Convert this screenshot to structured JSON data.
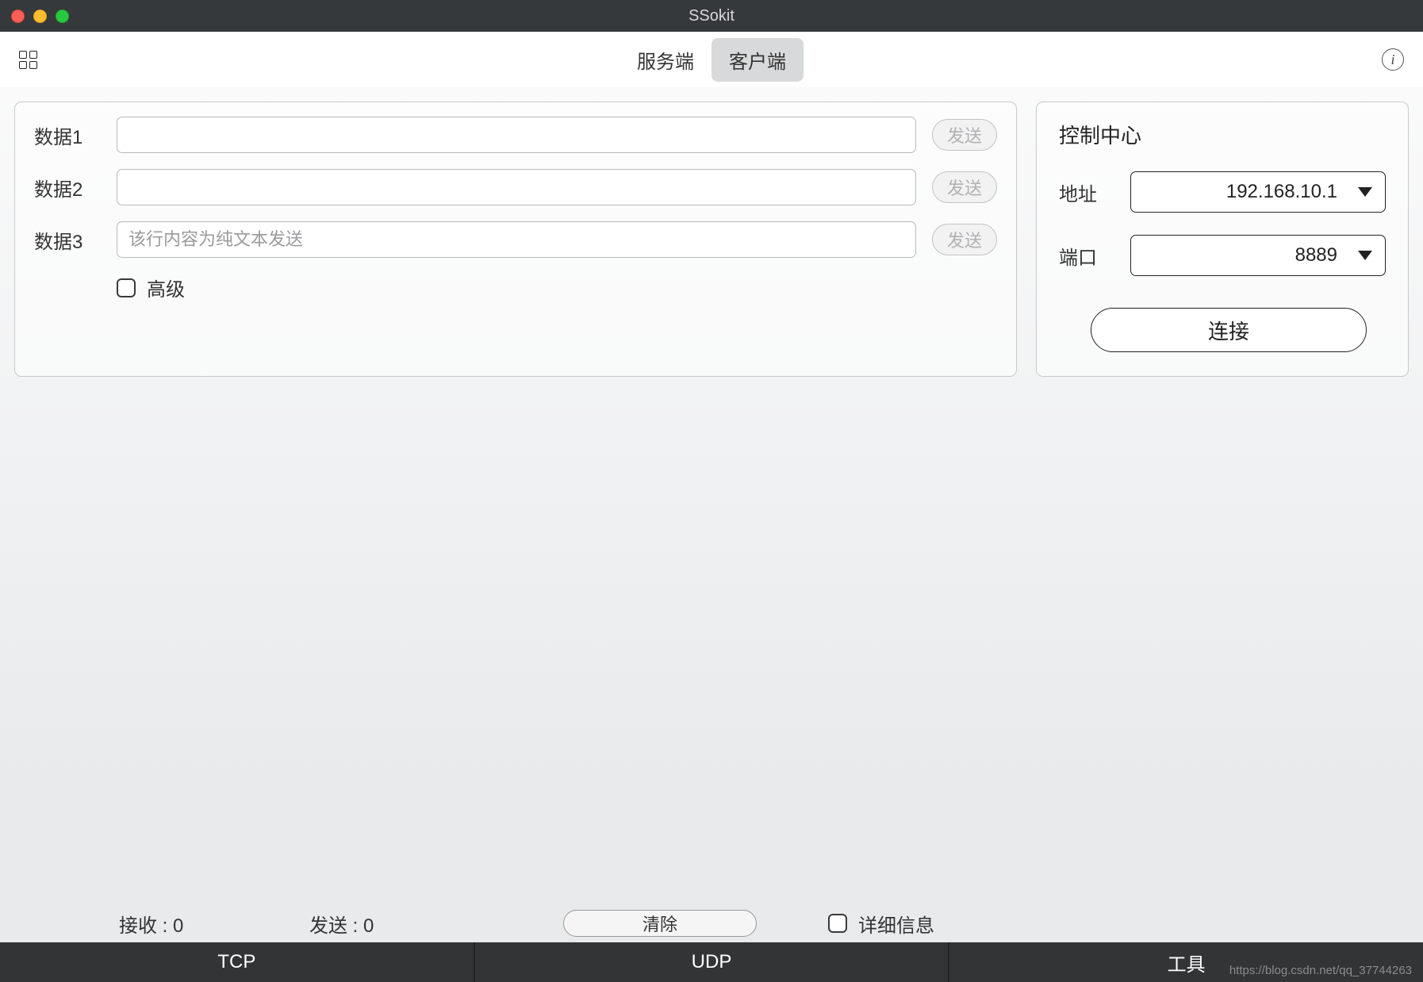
{
  "window": {
    "title": "SSokit"
  },
  "toolbar": {
    "tabs": [
      {
        "label": "服务端",
        "active": false
      },
      {
        "label": "客户端",
        "active": true
      }
    ]
  },
  "data_rows": [
    {
      "label": "数据1",
      "value": "",
      "placeholder": "",
      "send": "发送"
    },
    {
      "label": "数据2",
      "value": "",
      "placeholder": "",
      "send": "发送"
    },
    {
      "label": "数据3",
      "value": "",
      "placeholder": "该行内容为纯文本发送",
      "send": "发送"
    }
  ],
  "advanced": {
    "label": "高级",
    "checked": false
  },
  "control": {
    "title": "控制中心",
    "address_label": "地址",
    "address_value": "192.168.10.1",
    "port_label": "端口",
    "port_value": "8889",
    "connect": "连接"
  },
  "status": {
    "recv_label": "接收 :",
    "recv_value": "0",
    "send_label": "发送 :",
    "send_value": "0",
    "clear": "清除",
    "detail_label": "详细信息",
    "detail_checked": false
  },
  "bottom_tabs": [
    {
      "label": "TCP"
    },
    {
      "label": "UDP"
    },
    {
      "label": "工具"
    }
  ],
  "watermark": "https://blog.csdn.net/qq_37744263"
}
